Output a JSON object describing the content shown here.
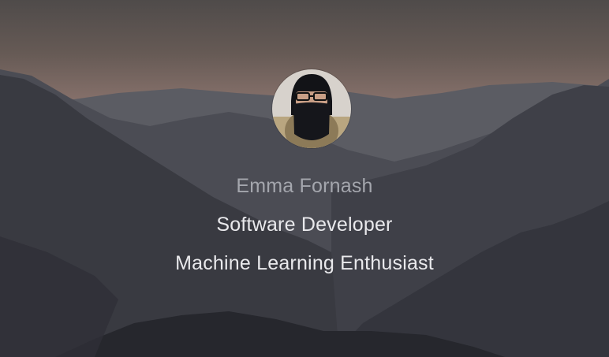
{
  "profile": {
    "name": "Emma Fornash",
    "taglines": [
      "Software Developer",
      "Machine Learning Enthusiast"
    ],
    "avatar_icon": "profile-photo"
  },
  "colors": {
    "sky_top": "#5a5553",
    "sky_glow": "#8b7468",
    "mountain_dark": "#2b2c33",
    "name_text": "#a4a6ad",
    "tagline_text": "#e9e9ec"
  }
}
